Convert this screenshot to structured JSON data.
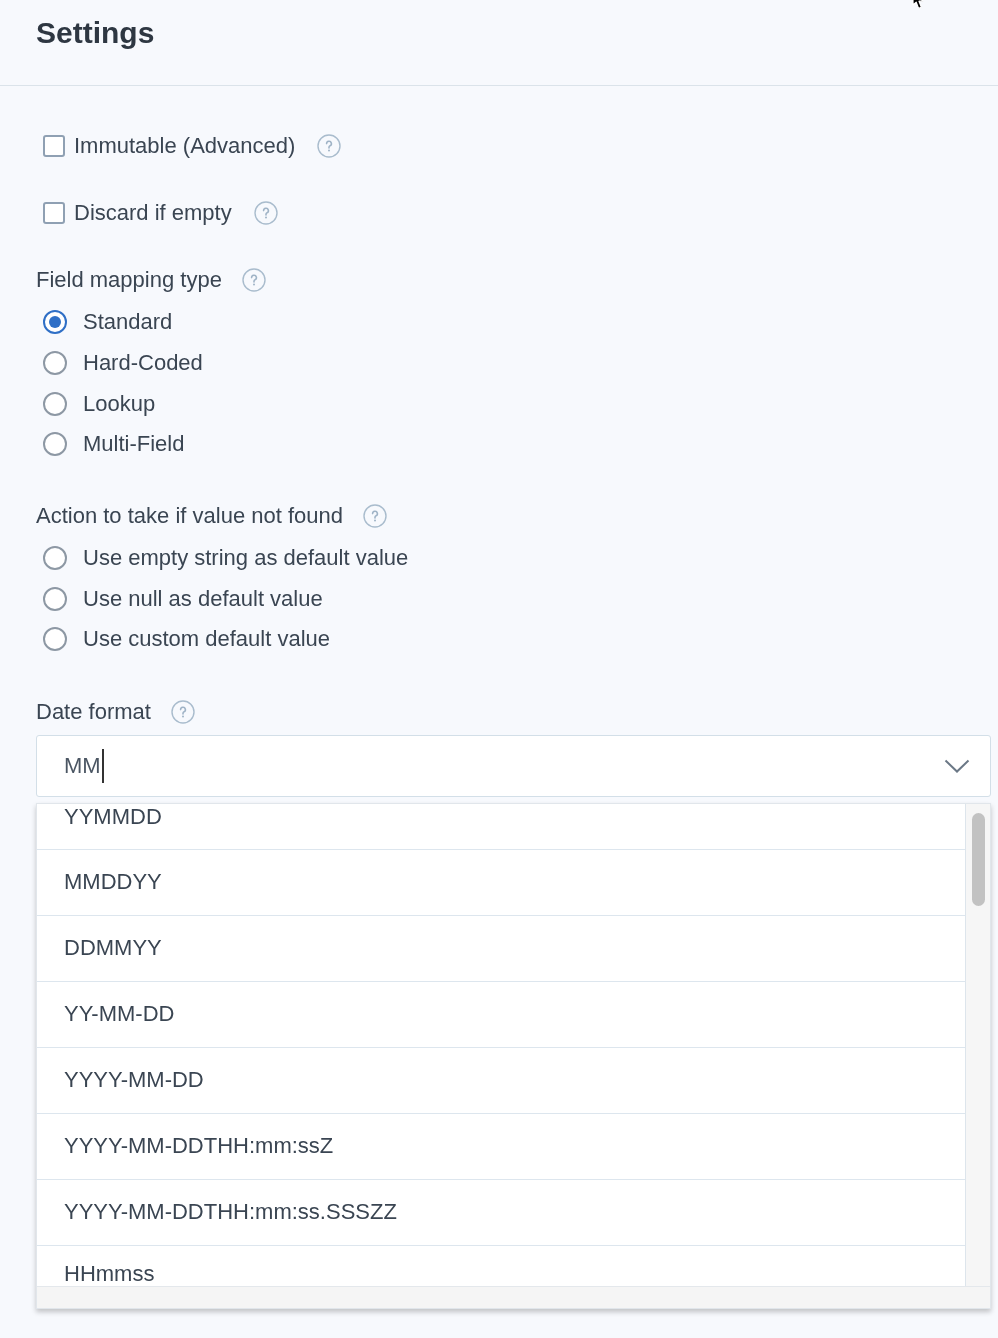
{
  "page": {
    "title": "Settings"
  },
  "checkboxes": [
    {
      "label": "Immutable (Advanced)",
      "checked": false
    },
    {
      "label": "Discard if empty",
      "checked": false
    }
  ],
  "field_mapping_type": {
    "label": "Field mapping type",
    "options": [
      {
        "label": "Standard",
        "selected": true
      },
      {
        "label": "Hard-Coded",
        "selected": false
      },
      {
        "label": "Lookup",
        "selected": false
      },
      {
        "label": "Multi-Field",
        "selected": false
      }
    ]
  },
  "action_if_not_found": {
    "label": "Action to take if value not found",
    "options": [
      {
        "label": "Use empty string as default value",
        "selected": false
      },
      {
        "label": "Use null as default value",
        "selected": false
      },
      {
        "label": "Use custom default value",
        "selected": false
      }
    ]
  },
  "date_format": {
    "label": "Date format",
    "value": "MM",
    "expanded": true,
    "options": [
      "YYMMDD",
      "MMDDYY",
      "DDMMYY",
      "YY-MM-DD",
      "YYYY-MM-DD",
      "YYYY-MM-DDTHH:mm:ssZ",
      "YYYY-MM-DDTHH:mm:ss.SSSZZ",
      "HHmmss"
    ]
  }
}
